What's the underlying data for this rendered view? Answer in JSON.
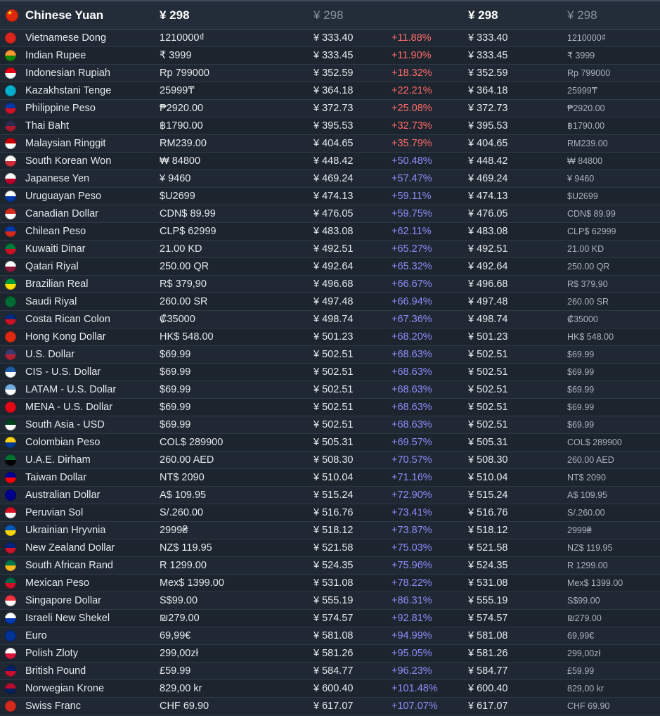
{
  "base": {
    "name": "Chinese Yuan",
    "local": "¥ 298",
    "cny": "¥ 298",
    "cny2": "¥ 298",
    "local2": "¥ 298",
    "flag": [
      "#de2910",
      "#de2910"
    ]
  },
  "colors": {
    "background": "#1b2838",
    "diff_high_red": "#ff6b6b",
    "diff_blue": "#8f8cf8"
  },
  "rows": [
    {
      "name": "Vietnamese Dong",
      "local": "1210000₫",
      "cny": "¥ 333.40",
      "diff": "+11.88%",
      "cny2": "¥ 333.40",
      "local2": "1210000₫",
      "tone": "red",
      "flag": [
        "#da251d",
        "#da251d"
      ]
    },
    {
      "name": "Indian Rupee",
      "local": "₹ 3999",
      "cny": "¥ 333.45",
      "diff": "+11.90%",
      "cny2": "¥ 333.45",
      "local2": "₹ 3999",
      "tone": "red",
      "flag": [
        "#ff9933",
        "#138808"
      ]
    },
    {
      "name": "Indonesian Rupiah",
      "local": "Rp 799000",
      "cny": "¥ 352.59",
      "diff": "+18.32%",
      "cny2": "¥ 352.59",
      "local2": "Rp 799000",
      "tone": "red",
      "flag": [
        "#e70011",
        "#ffffff"
      ]
    },
    {
      "name": "Kazakhstani Tenge",
      "local": "25999₸",
      "cny": "¥ 364.18",
      "diff": "+22.21%",
      "cny2": "¥ 364.18",
      "local2": "25999₸",
      "tone": "red",
      "flag": [
        "#00afca",
        "#00afca"
      ]
    },
    {
      "name": "Philippine Peso",
      "local": "₱2920.00",
      "cny": "¥ 372.73",
      "diff": "+25.08%",
      "cny2": "¥ 372.73",
      "local2": "₱2920.00",
      "tone": "red",
      "flag": [
        "#0038a8",
        "#ce1126"
      ]
    },
    {
      "name": "Thai Baht",
      "local": "฿1790.00",
      "cny": "¥ 395.53",
      "diff": "+32.73%",
      "cny2": "¥ 395.53",
      "local2": "฿1790.00",
      "tone": "red",
      "flag": [
        "#2d2a4a",
        "#a51931"
      ]
    },
    {
      "name": "Malaysian Ringgit",
      "local": "RM239.00",
      "cny": "¥ 404.65",
      "diff": "+35.79%",
      "cny2": "¥ 404.65",
      "local2": "RM239.00",
      "tone": "red",
      "flag": [
        "#cc0001",
        "#ffffff"
      ]
    },
    {
      "name": "South Korean Won",
      "local": "₩ 84800",
      "cny": "¥ 448.42",
      "diff": "+50.48%",
      "cny2": "¥ 448.42",
      "local2": "₩ 84800",
      "tone": "blue",
      "flag": [
        "#ffffff",
        "#cd2e3a"
      ]
    },
    {
      "name": "Japanese Yen",
      "local": "¥ 9460",
      "cny": "¥ 469.24",
      "diff": "+57.47%",
      "cny2": "¥ 469.24",
      "local2": "¥ 9460",
      "tone": "blue",
      "flag": [
        "#ffffff",
        "#bc002d"
      ]
    },
    {
      "name": "Uruguayan Peso",
      "local": "$U2699",
      "cny": "¥ 474.13",
      "diff": "+59.11%",
      "cny2": "¥ 474.13",
      "local2": "$U2699",
      "tone": "blue",
      "flag": [
        "#ffffff",
        "#0038a8"
      ]
    },
    {
      "name": "Canadian Dollar",
      "local": "CDN$ 89.99",
      "cny": "¥ 476.05",
      "diff": "+59.75%",
      "cny2": "¥ 476.05",
      "local2": "CDN$ 89.99",
      "tone": "blue",
      "flag": [
        "#d52b1e",
        "#ffffff"
      ]
    },
    {
      "name": "Chilean Peso",
      "local": "CLP$ 62999",
      "cny": "¥ 483.08",
      "diff": "+62.11%",
      "cny2": "¥ 483.08",
      "local2": "CLP$ 62999",
      "tone": "blue",
      "flag": [
        "#0039a6",
        "#d52b1e"
      ]
    },
    {
      "name": "Kuwaiti Dinar",
      "local": "21.00 KD",
      "cny": "¥ 492.51",
      "diff": "+65.27%",
      "cny2": "¥ 492.51",
      "local2": "21.00 KD",
      "tone": "blue",
      "flag": [
        "#007a3d",
        "#ce1126"
      ]
    },
    {
      "name": "Qatari Riyal",
      "local": "250.00 QR",
      "cny": "¥ 492.64",
      "diff": "+65.32%",
      "cny2": "¥ 492.64",
      "local2": "250.00 QR",
      "tone": "blue",
      "flag": [
        "#ffffff",
        "#8a1538"
      ]
    },
    {
      "name": "Brazilian Real",
      "local": "R$ 379,90",
      "cny": "¥ 496.68",
      "diff": "+66.67%",
      "cny2": "¥ 496.68",
      "local2": "R$ 379,90",
      "tone": "blue",
      "flag": [
        "#009c3b",
        "#ffdf00"
      ]
    },
    {
      "name": "Saudi Riyal",
      "local": "260.00 SR",
      "cny": "¥ 497.48",
      "diff": "+66.94%",
      "cny2": "¥ 497.48",
      "local2": "260.00 SR",
      "tone": "blue",
      "flag": [
        "#006c35",
        "#006c35"
      ]
    },
    {
      "name": "Costa Rican Colon",
      "local": "₡35000",
      "cny": "¥ 498.74",
      "diff": "+67.36%",
      "cny2": "¥ 498.74",
      "local2": "₡35000",
      "tone": "blue",
      "flag": [
        "#002b7f",
        "#ce1126"
      ]
    },
    {
      "name": "Hong Kong Dollar",
      "local": "HK$ 548.00",
      "cny": "¥ 501.23",
      "diff": "+68.20%",
      "cny2": "¥ 501.23",
      "local2": "HK$ 548.00",
      "tone": "blue",
      "flag": [
        "#de2910",
        "#de2910"
      ]
    },
    {
      "name": "U.S. Dollar",
      "local": "$69.99",
      "cny": "¥ 502.51",
      "diff": "+68.63%",
      "cny2": "¥ 502.51",
      "local2": "$69.99",
      "tone": "blue",
      "flag": [
        "#3c3b6e",
        "#b22234"
      ]
    },
    {
      "name": "CIS - U.S. Dollar",
      "local": "$69.99",
      "cny": "¥ 502.51",
      "diff": "+68.63%",
      "cny2": "¥ 502.51",
      "local2": "$69.99",
      "tone": "blue",
      "flag": [
        "#1e5aa8",
        "#ffffff"
      ]
    },
    {
      "name": "LATAM - U.S. Dollar",
      "local": "$69.99",
      "cny": "¥ 502.51",
      "diff": "+68.63%",
      "cny2": "¥ 502.51",
      "local2": "$69.99",
      "tone": "blue",
      "flag": [
        "#74acdf",
        "#ffffff"
      ]
    },
    {
      "name": "MENA - U.S. Dollar",
      "local": "$69.99",
      "cny": "¥ 502.51",
      "diff": "+68.63%",
      "cny2": "¥ 502.51",
      "local2": "$69.99",
      "tone": "blue",
      "flag": [
        "#e30a17",
        "#e30a17"
      ]
    },
    {
      "name": "South Asia - USD",
      "local": "$69.99",
      "cny": "¥ 502.51",
      "diff": "+68.63%",
      "cny2": "¥ 502.51",
      "local2": "$69.99",
      "tone": "blue",
      "flag": [
        "#01411c",
        "#ffffff"
      ]
    },
    {
      "name": "Colombian Peso",
      "local": "COL$ 289900",
      "cny": "¥ 505.31",
      "diff": "+69.57%",
      "cny2": "¥ 505.31",
      "local2": "COL$ 289900",
      "tone": "blue",
      "flag": [
        "#fcd116",
        "#003893"
      ]
    },
    {
      "name": "U.A.E. Dirham",
      "local": "260.00 AED",
      "cny": "¥ 508.30",
      "diff": "+70.57%",
      "cny2": "¥ 508.30",
      "local2": "260.00 AED",
      "tone": "blue",
      "flag": [
        "#00732f",
        "#000000"
      ]
    },
    {
      "name": "Taiwan Dollar",
      "local": "NT$ 2090",
      "cny": "¥ 510.04",
      "diff": "+71.16%",
      "cny2": "¥ 510.04",
      "local2": "NT$ 2090",
      "tone": "blue",
      "flag": [
        "#000095",
        "#fe0000"
      ]
    },
    {
      "name": "Australian Dollar",
      "local": "A$ 109.95",
      "cny": "¥ 515.24",
      "diff": "+72.90%",
      "cny2": "¥ 515.24",
      "local2": "A$ 109.95",
      "tone": "blue",
      "flag": [
        "#00008b",
        "#00008b"
      ]
    },
    {
      "name": "Peruvian Sol",
      "local": "S/.260.00",
      "cny": "¥ 516.76",
      "diff": "+73.41%",
      "cny2": "¥ 516.76",
      "local2": "S/.260.00",
      "tone": "blue",
      "flag": [
        "#d91023",
        "#ffffff"
      ]
    },
    {
      "name": "Ukrainian Hryvnia",
      "local": "2999₴",
      "cny": "¥ 518.12",
      "diff": "+73.87%",
      "cny2": "¥ 518.12",
      "local2": "2999₴",
      "tone": "blue",
      "flag": [
        "#0057b7",
        "#ffd700"
      ]
    },
    {
      "name": "New Zealand Dollar",
      "local": "NZ$ 119.95",
      "cny": "¥ 521.58",
      "diff": "+75.03%",
      "cny2": "¥ 521.58",
      "local2": "NZ$ 119.95",
      "tone": "blue",
      "flag": [
        "#00247d",
        "#cc142b"
      ]
    },
    {
      "name": "South African Rand",
      "local": "R 1299.00",
      "cny": "¥ 524.35",
      "diff": "+75.96%",
      "cny2": "¥ 524.35",
      "local2": "R 1299.00",
      "tone": "blue",
      "flag": [
        "#007749",
        "#ffb81c"
      ]
    },
    {
      "name": "Mexican Peso",
      "local": "Mex$ 1399.00",
      "cny": "¥ 531.08",
      "diff": "+78.22%",
      "cny2": "¥ 531.08",
      "local2": "Mex$ 1399.00",
      "tone": "blue",
      "flag": [
        "#006847",
        "#ce1126"
      ]
    },
    {
      "name": "Singapore Dollar",
      "local": "S$99.00",
      "cny": "¥ 555.19",
      "diff": "+86.31%",
      "cny2": "¥ 555.19",
      "local2": "S$99.00",
      "tone": "blue",
      "flag": [
        "#ef3340",
        "#ffffff"
      ]
    },
    {
      "name": "Israeli New Shekel",
      "local": "₪279.00",
      "cny": "¥ 574.57",
      "diff": "+92.81%",
      "cny2": "¥ 574.57",
      "local2": "₪279.00",
      "tone": "blue",
      "flag": [
        "#ffffff",
        "#0038b8"
      ]
    },
    {
      "name": "Euro",
      "local": "69,99€",
      "cny": "¥ 581.08",
      "diff": "+94.99%",
      "cny2": "¥ 581.08",
      "local2": "69,99€",
      "tone": "blue",
      "flag": [
        "#003399",
        "#003399"
      ]
    },
    {
      "name": "Polish Zloty",
      "local": "299,00zł",
      "cny": "¥ 581.26",
      "diff": "+95.05%",
      "cny2": "¥ 581.26",
      "local2": "299,00zł",
      "tone": "blue",
      "flag": [
        "#ffffff",
        "#dc143c"
      ]
    },
    {
      "name": "British Pound",
      "local": "£59.99",
      "cny": "¥ 584.77",
      "diff": "+96.23%",
      "cny2": "¥ 584.77",
      "local2": "£59.99",
      "tone": "blue",
      "flag": [
        "#012169",
        "#c8102e"
      ]
    },
    {
      "name": "Norwegian Krone",
      "local": "829,00 kr",
      "cny": "¥ 600.40",
      "diff": "+101.48%",
      "cny2": "¥ 600.40",
      "local2": "829,00 kr",
      "tone": "blue",
      "flag": [
        "#ba0c2f",
        "#00205b"
      ]
    },
    {
      "name": "Swiss Franc",
      "local": "CHF 69.90",
      "cny": "¥ 617.07",
      "diff": "+107.07%",
      "cny2": "¥ 617.07",
      "local2": "CHF 69.90",
      "tone": "blue",
      "flag": [
        "#d52b1e",
        "#d52b1e"
      ]
    }
  ]
}
